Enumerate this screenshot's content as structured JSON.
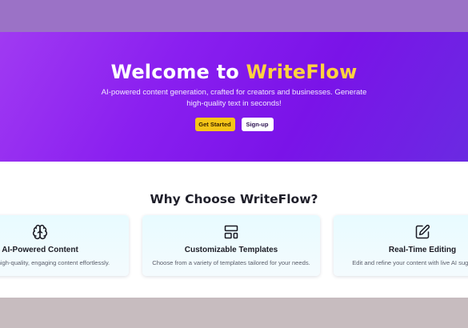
{
  "hero": {
    "title_prefix": "Welcome to ",
    "title_brand": "WriteFlow",
    "subtitle": "AI-powered content generation, crafted for creators and businesses. Generate high-quality text in seconds!",
    "primary_button": "Get Started",
    "secondary_button": "Sign-up"
  },
  "features": {
    "title": "Why Choose WriteFlow?",
    "cards": [
      {
        "icon": "brain-icon",
        "title": "AI-Powered Content",
        "description": "Generate high-quality, engaging content effortlessly."
      },
      {
        "icon": "layout-template-icon",
        "title": "Customizable Templates",
        "description": "Choose from a variety of templates tailored for your needs."
      },
      {
        "icon": "edit-icon",
        "title": "Real-Time Editing",
        "description": "Edit and refine your content with live AI suggestions."
      }
    ]
  },
  "colors": {
    "hero_gradient_start": "#a03af2",
    "hero_gradient_end": "#6a2ae2",
    "brand_accent": "#ffd23f",
    "primary_button": "#f5c518",
    "card_background": "#e8fbff"
  }
}
